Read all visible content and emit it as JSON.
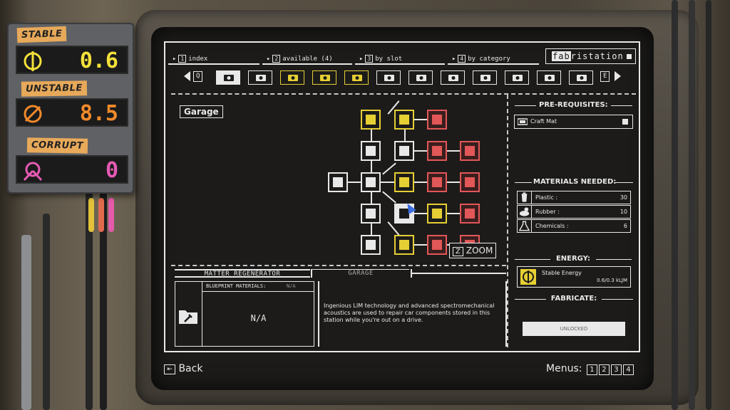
{
  "gauges": [
    {
      "label": "STABLE",
      "value": "0.6",
      "color": "#f3e13a"
    },
    {
      "label": "UNSTABLE",
      "value": "8.5",
      "color": "#f08a2a"
    },
    {
      "label": "CORRUPT",
      "value": "0",
      "color": "#e65ab4"
    }
  ],
  "nav": {
    "tabs": [
      {
        "num": "1",
        "label": "index"
      },
      {
        "num": "2",
        "label": "available (4)"
      },
      {
        "num": "3",
        "label": "by slot"
      },
      {
        "num": "4",
        "label": "by category"
      }
    ],
    "brand_fab": "fab",
    "brand_rest": "ristation",
    "prev_key": "Q",
    "next_key": "E"
  },
  "categories": [
    {
      "icon": "fabricator-icon",
      "state": "active"
    },
    {
      "icon": "gear-icon",
      "state": "normal"
    },
    {
      "icon": "tools-icon",
      "state": "yellow"
    },
    {
      "icon": "drink-icon",
      "state": "yellow"
    },
    {
      "icon": "box-icon",
      "state": "yellow"
    },
    {
      "icon": "tire-icon",
      "state": "normal"
    },
    {
      "icon": "car-icon",
      "state": "normal"
    },
    {
      "icon": "car-side-icon",
      "state": "normal"
    },
    {
      "icon": "chassis-icon",
      "state": "normal"
    },
    {
      "icon": "engine-icon",
      "state": "normal"
    },
    {
      "icon": "crane-icon",
      "state": "normal"
    },
    {
      "icon": "device-icon",
      "state": "normal"
    }
  ],
  "tree": {
    "label": "Garage",
    "zoom_key": "Z",
    "zoom_label": "ZOOM"
  },
  "prereq": {
    "title": "PRE-REQUISITES:",
    "items": [
      "Craft Mat"
    ]
  },
  "materials": {
    "title": "MATERIALS NEEDED:",
    "items": [
      {
        "name": "Plastic",
        "sep": ":",
        "qty": "30"
      },
      {
        "name": "Rubber",
        "sep": ":",
        "qty": "10"
      },
      {
        "name": "Chemicals",
        "sep": ":",
        "qty": "6"
      }
    ]
  },
  "energy": {
    "title": "ENERGY:",
    "name": "Stable Energy",
    "value": "0.6/0.3 kLJM"
  },
  "fabricate": {
    "title": "FABRICATE:",
    "button": "UNLOCKED"
  },
  "bottom": {
    "tab_active": "MATTER REGENERATOR",
    "tab_other": "GARAGE",
    "bp_title": "BLUEPRINT MATERIALS:",
    "bp_na_small": "N/A",
    "bp_value": "N/A",
    "description": "Ingenious LIM technology and advanced spectromechanical acoustics are used to repair car components stored in this station while you're out on a drive."
  },
  "footer": {
    "back_label": "Back",
    "menus_label": "Menus:",
    "menus": [
      "1",
      "2",
      "3",
      "4"
    ]
  },
  "colors": {
    "white": "#e8e8e8",
    "yellow": "#e6cf33",
    "red": "#e25757",
    "screen": "#1c1b1a"
  }
}
